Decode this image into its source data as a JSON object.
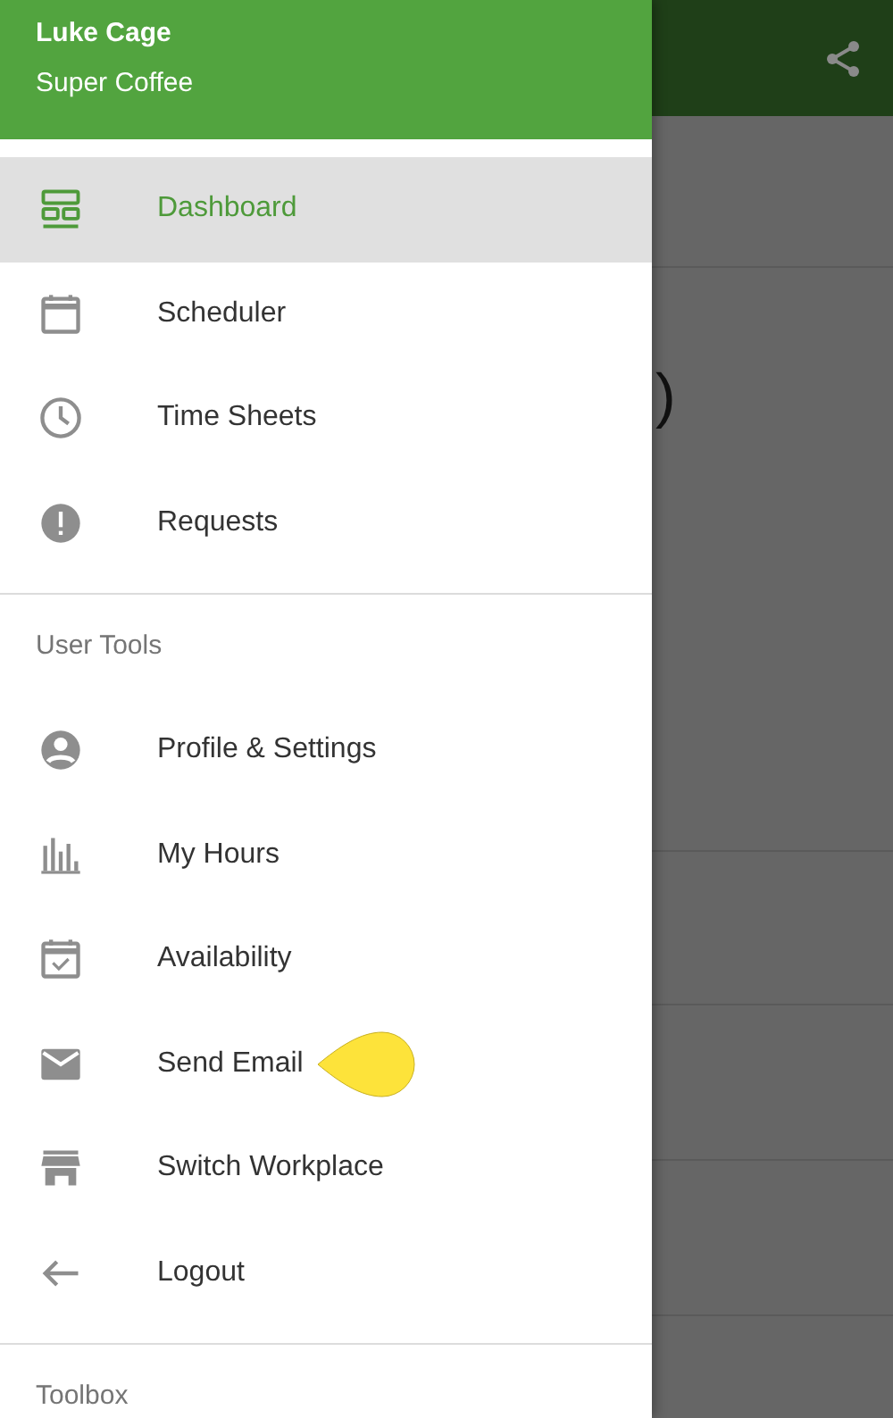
{
  "header": {
    "user_name": "Luke Cage",
    "workplace": "Super Coffee"
  },
  "background": {
    "fragment": ")"
  },
  "sections": [
    {
      "items": [
        {
          "label": "Dashboard",
          "kind": "dashboard",
          "selected": true,
          "callout": false
        },
        {
          "label": "Scheduler",
          "kind": "calendar",
          "selected": false,
          "callout": false
        },
        {
          "label": "Time Sheets",
          "kind": "clock",
          "selected": false,
          "callout": false
        },
        {
          "label": "Requests",
          "kind": "alert",
          "selected": false,
          "callout": false
        }
      ]
    },
    {
      "heading": "User Tools",
      "items": [
        {
          "label": "Profile & Settings",
          "kind": "person",
          "selected": false,
          "callout": false
        },
        {
          "label": "My Hours",
          "kind": "bars",
          "selected": false,
          "callout": false
        },
        {
          "label": "Availability",
          "kind": "availability",
          "selected": false,
          "callout": false
        },
        {
          "label": "Send Email",
          "kind": "mail",
          "selected": false,
          "callout": true
        },
        {
          "label": "Switch Workplace",
          "kind": "store",
          "selected": false,
          "callout": false
        },
        {
          "label": "Logout",
          "kind": "logout",
          "selected": false,
          "callout": false
        }
      ]
    },
    {
      "heading": "Toolbox"
    }
  ]
}
